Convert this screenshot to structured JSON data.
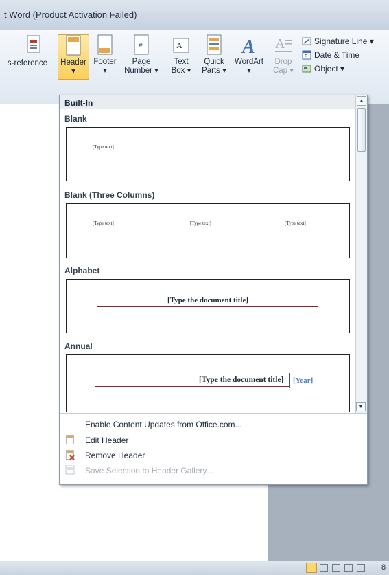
{
  "window": {
    "title": "t Word (Product Activation Failed)"
  },
  "ribbon": {
    "cross_reference": "s-reference",
    "header_l1": "Header",
    "header_l2": "▾",
    "footer_l1": "Footer",
    "footer_l2": "▾",
    "page_l1": "Page",
    "page_l2": "Number ▾",
    "textbox_l1": "Text",
    "textbox_l2": "Box ▾",
    "quickparts_l1": "Quick",
    "quickparts_l2": "Parts ▾",
    "wordart_l1": "WordArt",
    "wordart_l2": "▾",
    "dropcap_l1": "Drop",
    "dropcap_l2": "Cap ▾",
    "signature_line": "Signature Line ▾",
    "date_time": "Date & Time",
    "object": "Object ▾"
  },
  "gallery": {
    "heading": "Built-In",
    "sections": [
      {
        "name": "Blank",
        "placeholders": [
          "[Type text]"
        ]
      },
      {
        "name": "Blank (Three Columns)",
        "placeholders": [
          "[Type text]",
          "[Type text]",
          "[Type text]"
        ]
      },
      {
        "name": "Alphabet",
        "placeholders": [
          "[Type the document title]"
        ]
      },
      {
        "name": "Annual",
        "placeholders": [
          "[Type the document title]",
          "[Year]"
        ]
      }
    ]
  },
  "menu": {
    "enable_updates": "Enable Content Updates from Office.com...",
    "edit_header": "Edit Header",
    "remove_header": "Remove Header",
    "save_selection": "Save Selection to Header Gallery..."
  },
  "statusbar": {
    "zoom": "8"
  },
  "colors": {
    "accent_red": "#8b2a22",
    "year_blue": "#4f7fb9",
    "selected": "#fbd86e"
  }
}
